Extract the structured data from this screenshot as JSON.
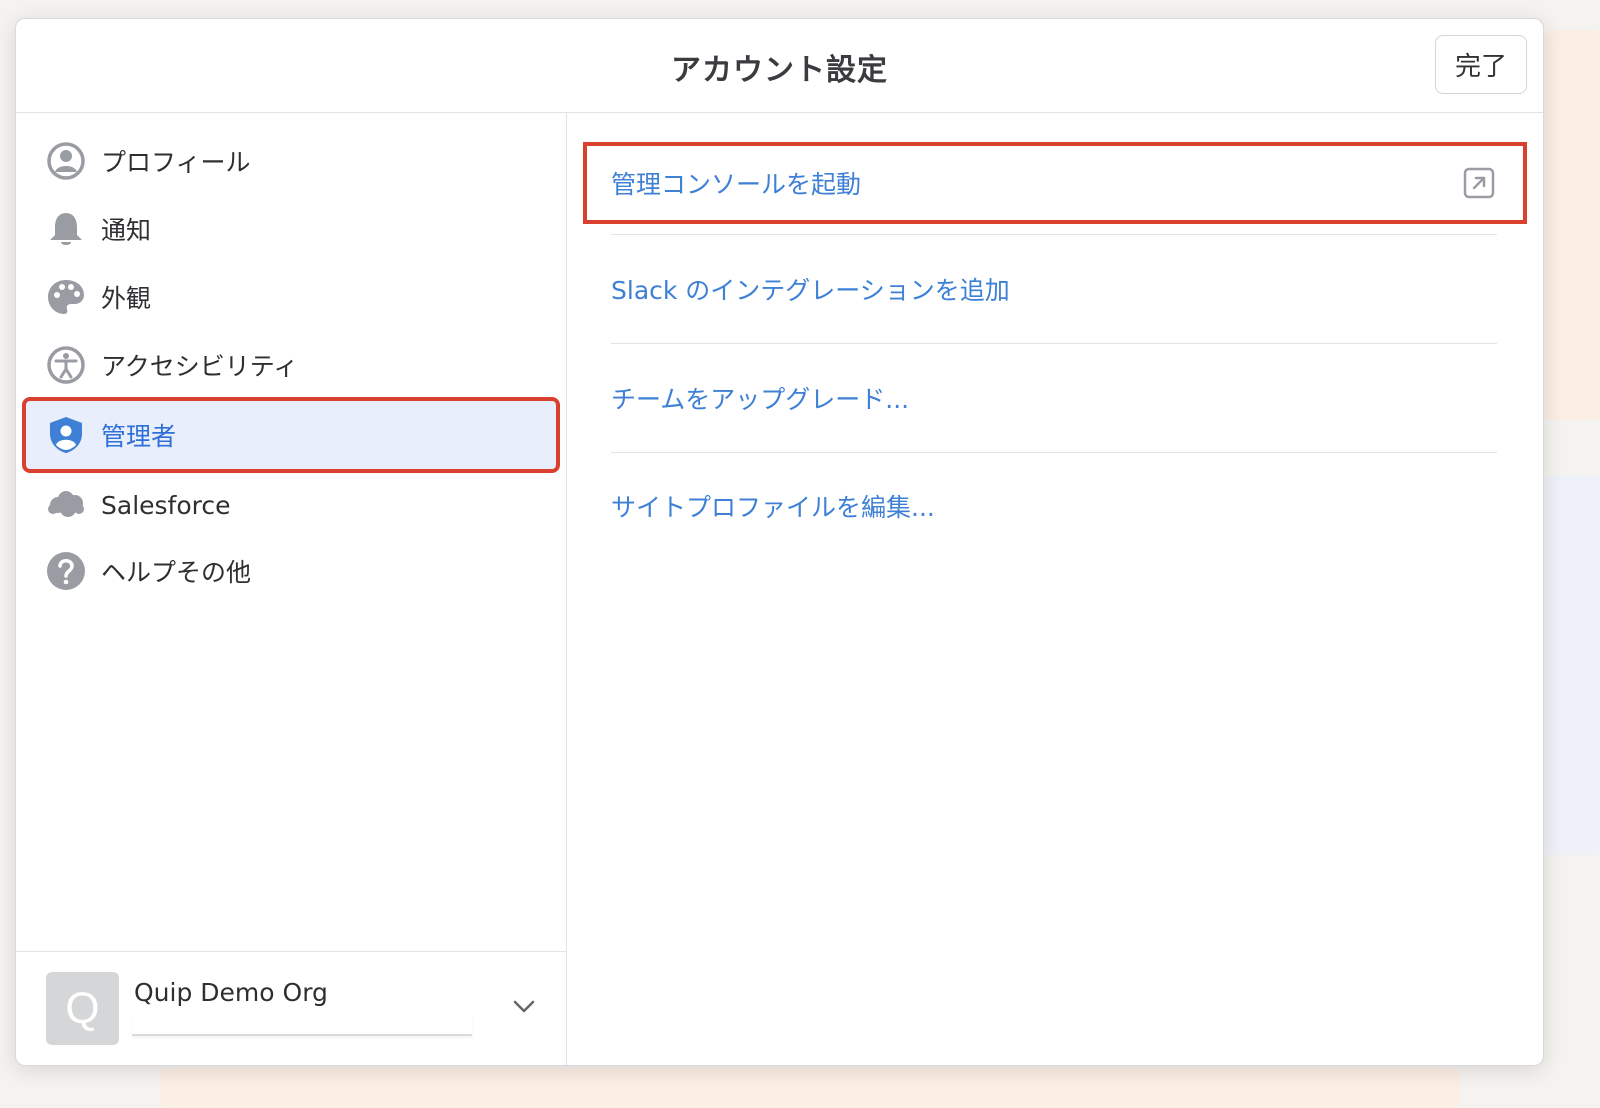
{
  "dialog": {
    "title": "アカウント設定",
    "done_label": "完了"
  },
  "sidebar": {
    "items": [
      {
        "label": "プロフィール",
        "icon": "profile-icon"
      },
      {
        "label": "通知",
        "icon": "bell-icon"
      },
      {
        "label": "外観",
        "icon": "palette-icon"
      },
      {
        "label": "アクセシビリティ",
        "icon": "accessibility-icon"
      },
      {
        "label": "管理者",
        "icon": "admin-shield-icon",
        "selected": true
      },
      {
        "label": "Salesforce",
        "icon": "salesforce-cloud-icon"
      },
      {
        "label": "ヘルプその他",
        "icon": "help-icon"
      }
    ],
    "org": {
      "avatar_letter": "Q",
      "name": "Quip Demo Org"
    }
  },
  "content": {
    "actions": [
      {
        "label": "管理コンソールを起動",
        "icon": "external-link-icon"
      },
      {
        "label": "Slack のインテグレーションを追加"
      },
      {
        "label": "チームをアップグレード..."
      },
      {
        "label": "サイトプロファイルを編集..."
      }
    ]
  },
  "colors": {
    "accent": "#3d80d6",
    "selected_bg": "#e8eefc",
    "highlight_border": "#d9412e",
    "icon_gray": "#9a9ca3"
  }
}
